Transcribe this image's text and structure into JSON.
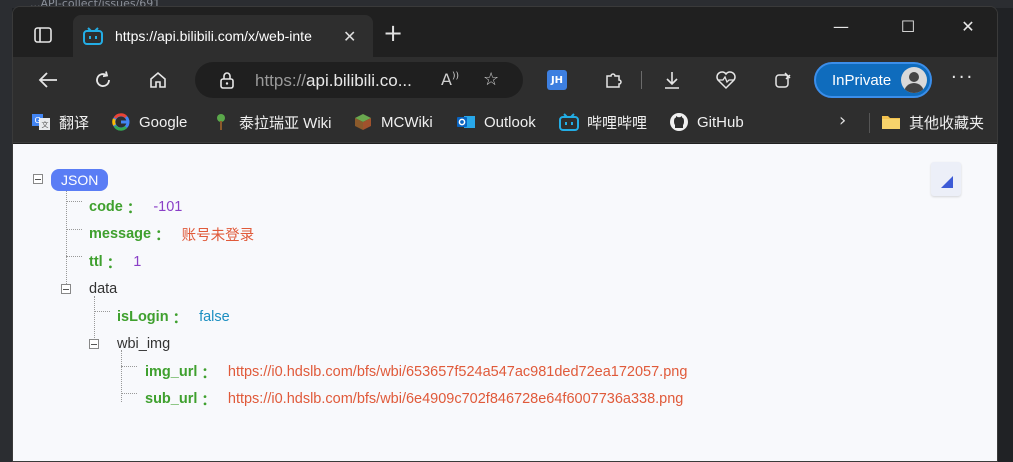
{
  "background_page": {
    "title_fragment": "...API-collect/issues/691"
  },
  "tab": {
    "title": "https://api.bilibili.com/x/web-inte",
    "close": "✕"
  },
  "window_controls": {
    "minimize": "—",
    "maximize": "☐",
    "close": "✕"
  },
  "toolbar": {
    "address_scheme": "https://",
    "address_host": "api.bilibili.co...",
    "extension_badge": "JH",
    "inprivate_label": "InPrivate",
    "more": "···"
  },
  "bookmarks": [
    {
      "label": "翻译",
      "icon": "translate-icon"
    },
    {
      "label": "Google",
      "icon": "google-icon"
    },
    {
      "label": "泰拉瑞亚 Wiki",
      "icon": "terraria-icon"
    },
    {
      "label": "MCWiki",
      "icon": "minecraft-icon"
    },
    {
      "label": "Outlook",
      "icon": "outlook-icon"
    },
    {
      "label": "哔哩哔哩",
      "icon": "bilibili-icon"
    },
    {
      "label": "GitHub",
      "icon": "github-icon"
    },
    {
      "label": "其他收藏夹",
      "icon": "folder-icon"
    }
  ],
  "json_view": {
    "root_label": "JSON",
    "code_key": "code",
    "code_value": "-101",
    "message_key": "message",
    "message_value": "账号未登录",
    "ttl_key": "ttl",
    "ttl_value": "1",
    "data_key": "data",
    "islogin_key": "isLogin",
    "islogin_value": "false",
    "wbi_img_key": "wbi_img",
    "img_url_key": "img_url",
    "img_url_value": "https://i0.hdslb.com/bfs/wbi/653657f524a547ac981ded72ea172057.png",
    "sub_url_key": "sub_url",
    "sub_url_value": "https://i0.hdslb.com/bfs/wbi/6e4909c702f846728e64f6007736a338.png",
    "colon": "："
  },
  "colors": {
    "key": "#3fa02e",
    "number": "#8a3fc7",
    "string": "#e05a3a",
    "boolean": "#1b8fc1",
    "inprivate": "#0f6cbd",
    "json_badge": "#5a7df5"
  }
}
